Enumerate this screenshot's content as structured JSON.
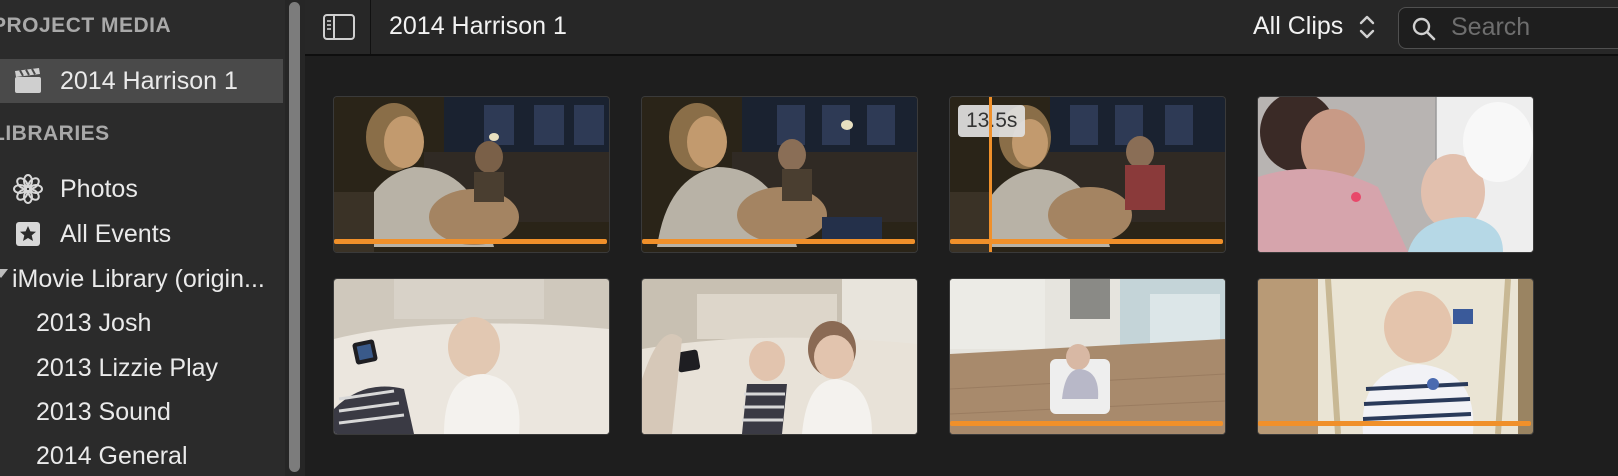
{
  "sidebar": {
    "project_media_header": "PROJECT MEDIA",
    "project_item": "2014 Harrison 1",
    "libraries_header": "LIBRARIES",
    "photos": "Photos",
    "all_events": "All Events",
    "library": "iMovie Library (origin...",
    "events": [
      "2013 Josh",
      "2013 Lizzie Play",
      "2013 Sound",
      "2014 General"
    ]
  },
  "toolbar": {
    "title": "2014 Harrison 1",
    "filter": "All Clips",
    "search_placeholder": "Search"
  },
  "clips": [
    {
      "used": true
    },
    {
      "used": true
    },
    {
      "used": true,
      "skimming": true,
      "duration": "13.5s"
    },
    {
      "used": false
    },
    {
      "used": false
    },
    {
      "used": false
    },
    {
      "used": true
    },
    {
      "used": true
    }
  ],
  "colors": {
    "accent": "#f0902a",
    "sidebar_bg": "#2b2b2b",
    "selected_bg": "#4a4a4a",
    "browser_bg": "#1e1e1e"
  }
}
